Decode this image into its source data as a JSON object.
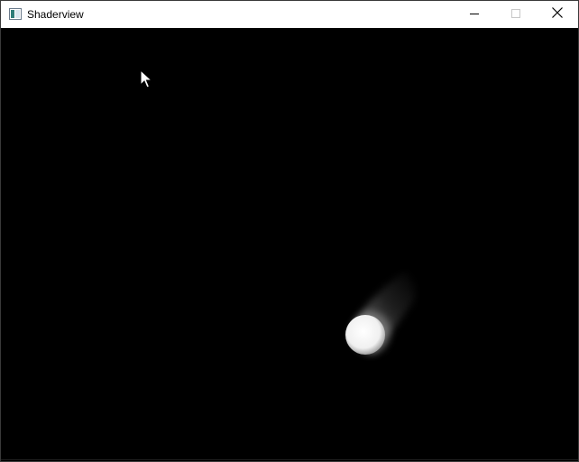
{
  "window": {
    "title": "Shaderview",
    "icons": {
      "app": "shaderview-app-icon",
      "minimize": "minimize-icon",
      "maximize": "maximize-icon",
      "close": "close-icon",
      "cursor": "mouse-pointer-icon"
    },
    "colors": {
      "titlebar": "#ffffff",
      "background": "#000000",
      "ball": "#ffffff"
    }
  }
}
